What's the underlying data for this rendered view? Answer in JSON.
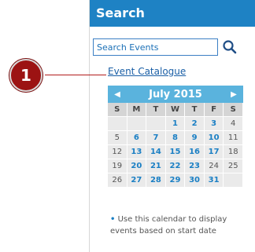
{
  "search": {
    "title": "Search",
    "placeholder": "Search Events",
    "catalogue_link": "Event Catalogue"
  },
  "callout": {
    "number": "1"
  },
  "calendar": {
    "month_label": "July 2015",
    "prev": "◀",
    "next": "▶",
    "weekdays": [
      "S",
      "M",
      "T",
      "W",
      "T",
      "F",
      "S"
    ],
    "weeks": [
      [
        {
          "d": "",
          "ev": false
        },
        {
          "d": "",
          "ev": false
        },
        {
          "d": "",
          "ev": false
        },
        {
          "d": "1",
          "ev": true
        },
        {
          "d": "2",
          "ev": true
        },
        {
          "d": "3",
          "ev": true
        },
        {
          "d": "4",
          "ev": false
        }
      ],
      [
        {
          "d": "5",
          "ev": false
        },
        {
          "d": "6",
          "ev": true
        },
        {
          "d": "7",
          "ev": true
        },
        {
          "d": "8",
          "ev": true
        },
        {
          "d": "9",
          "ev": true
        },
        {
          "d": "10",
          "ev": true
        },
        {
          "d": "11",
          "ev": false
        }
      ],
      [
        {
          "d": "12",
          "ev": false
        },
        {
          "d": "13",
          "ev": true
        },
        {
          "d": "14",
          "ev": true
        },
        {
          "d": "15",
          "ev": true
        },
        {
          "d": "16",
          "ev": true
        },
        {
          "d": "17",
          "ev": true
        },
        {
          "d": "18",
          "ev": false
        }
      ],
      [
        {
          "d": "19",
          "ev": false
        },
        {
          "d": "20",
          "ev": true
        },
        {
          "d": "21",
          "ev": true
        },
        {
          "d": "22",
          "ev": true
        },
        {
          "d": "23",
          "ev": true
        },
        {
          "d": "24",
          "ev": false
        },
        {
          "d": "25",
          "ev": false
        }
      ],
      [
        {
          "d": "26",
          "ev": false
        },
        {
          "d": "27",
          "ev": true
        },
        {
          "d": "28",
          "ev": true
        },
        {
          "d": "29",
          "ev": true
        },
        {
          "d": "30",
          "ev": true
        },
        {
          "d": "31",
          "ev": true
        },
        {
          "d": "",
          "ev": false
        }
      ]
    ]
  },
  "note": {
    "bullet": "•",
    "text": "Use this calendar to display events based on start date"
  },
  "colors": {
    "header_bg": "#1e82c4",
    "calendar_header_bg": "#5ab3dd",
    "link": "#1a5fa6",
    "event_day": "#1a7fc4",
    "callout": "#9c1313"
  },
  "icons": {
    "search_button": "search-icon",
    "prev_month": "chevron-left-icon",
    "next_month": "chevron-right-icon"
  }
}
